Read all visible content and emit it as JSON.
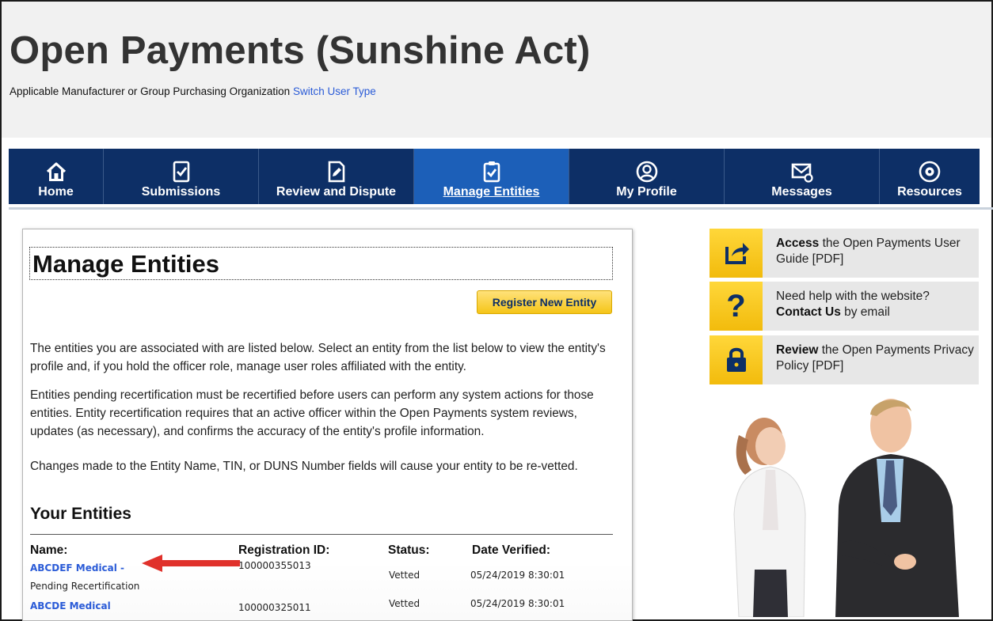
{
  "header": {
    "title": "Open Payments (Sunshine Act)",
    "user_type": "Applicable Manufacturer or Group Purchasing Organization",
    "switch_link": "Switch User Type"
  },
  "nav": {
    "items": [
      {
        "label": "Home",
        "icon": "home-icon"
      },
      {
        "label": "Submissions",
        "icon": "document-check-icon"
      },
      {
        "label": "Review and Dispute",
        "icon": "document-edit-icon"
      },
      {
        "label": "Manage Entities",
        "icon": "clipboard-check-icon",
        "active": true
      },
      {
        "label": "My Profile",
        "icon": "user-circle-icon"
      },
      {
        "label": "Messages",
        "icon": "envelope-icon"
      },
      {
        "label": "Resources",
        "icon": "gear-icon"
      }
    ]
  },
  "main": {
    "title": "Manage Entities",
    "register_button": "Register New Entity",
    "paragraphs": [
      "The entities you are associated with are listed below. Select an entity from the list below to view the entity's profile and, if you hold the officer role, manage user roles affiliated with the entity.",
      "Entities pending recertification must be recertified before users can perform any system actions for those entities. Entity recertification requires that an active officer within the Open Payments system reviews, updates (as necessary), and confirms the accuracy of the entity's profile information.",
      "Changes made to the Entity Name, TIN, or DUNS Number fields will cause your entity to be re-vetted."
    ],
    "entities_heading": "Your Entities",
    "columns": [
      "Name:",
      "Registration ID:",
      "Status:",
      "Date Verified:"
    ],
    "rows": [
      {
        "name": "ABCDEF Medical -",
        "note": "Pending Recertification",
        "registration_id": "100000355013",
        "status": "Vetted",
        "date_verified": "05/24/2019 8:30:01"
      },
      {
        "name": "ABCDE Medical",
        "note": "",
        "registration_id": "100000325011",
        "status": "Vetted",
        "date_verified": "05/24/2019 8:30:01"
      }
    ]
  },
  "sidebar": {
    "cards": [
      {
        "icon": "share-arrow-icon",
        "bold": "Access",
        "text": " the Open Payments User Guide [PDF]"
      },
      {
        "icon": "question-icon",
        "pre": "Need help with the website? ",
        "bold": "Contact Us",
        "text": " by email"
      },
      {
        "icon": "lock-icon",
        "bold": "Review",
        "text": " the Open Payments Privacy Policy [PDF]"
      }
    ]
  },
  "colors": {
    "nav_bg": "#0d2f66",
    "nav_active": "#1c5fb8",
    "accent_yellow": "#f5c518",
    "link": "#2a5bd7",
    "arrow": "#e0312b"
  }
}
